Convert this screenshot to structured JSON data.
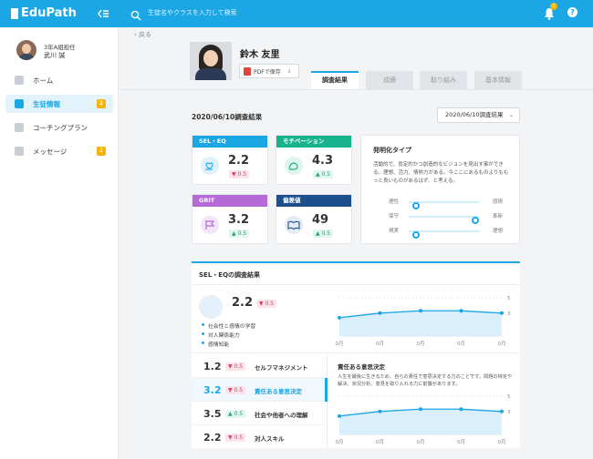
{
  "app": {
    "logo": "EduPath",
    "search_placeholder": "生徒名やクラスを入力して検索",
    "notification_count": "3",
    "help": "?"
  },
  "user": {
    "role": "3年A組担任",
    "name": "武川 誠"
  },
  "nav": [
    {
      "label": "ホーム",
      "icon": "home-icon",
      "count": ""
    },
    {
      "label": "生徒情報",
      "icon": "students-icon",
      "count": "2"
    },
    {
      "label": "コーチングプラン",
      "icon": "book-icon",
      "count": ""
    },
    {
      "label": "メッセージ",
      "icon": "message-icon",
      "count": "2"
    }
  ],
  "header": {
    "back": "‹ 戻る",
    "student_name": "鈴木 友里",
    "pdf": "PDFで保存"
  },
  "tabs": [
    "調査結果",
    "成績",
    "取り組み",
    "基本情報"
  ],
  "survey": {
    "date_title": "2020/06/10調査結果",
    "date_select": "2020/06/10調査結果"
  },
  "metrics": [
    {
      "title": "SEL・EQ",
      "value": "2.2",
      "delta": "▼ 0.5",
      "color": "#1ba6e6"
    },
    {
      "title": "モチベーション",
      "value": "4.3",
      "delta": "▲ 0.5",
      "color": "#16b38c"
    },
    {
      "title": "GRIT",
      "value": "3.2",
      "delta": "▲ 0.5",
      "color": "#b56ad8"
    },
    {
      "title": "偏差値",
      "value": "49",
      "delta": "▲ 0.5",
      "color": "#1d4f8c"
    }
  ],
  "type": {
    "title": "発明化タイプ",
    "desc": "活動的で、肯定的かつ創造的なビジョンを見出す事ができる。理想、活力、情熱力がある。今ここにあるものよりももっと良いものがあるはず、と考える。",
    "sliders": [
      {
        "left": "理性",
        "right": "感情",
        "level": 0.1
      },
      {
        "left": "保守",
        "right": "革新",
        "level": 0.95
      },
      {
        "left": "現実",
        "right": "理想",
        "level": 0.1
      }
    ]
  },
  "sel": {
    "title": "SEL・EQの調査結果",
    "value": "2.2",
    "delta": "▼ 0.5",
    "bullets": [
      "社会性と感情の学習",
      "対人関係能力",
      "感情知能"
    ],
    "chart_data": {
      "type": "area",
      "x": [
        "0月",
        "0月",
        "0月",
        "0月",
        "0月"
      ],
      "y": [
        2.4,
        3.0,
        3.3,
        3.3,
        3.0
      ],
      "ylim": [
        0,
        5
      ],
      "yticks": [
        "5",
        "3"
      ]
    },
    "items": [
      {
        "value": "1.2",
        "delta": "▼ 0.5",
        "name": "セルフマネジメント",
        "dir": "down"
      },
      {
        "value": "3.2",
        "delta": "▼ 0.5",
        "name": "責任ある意思決定",
        "dir": "down"
      },
      {
        "value": "3.5",
        "delta": "▲ 0.5",
        "name": "社会や他者への理解",
        "dir": "up"
      },
      {
        "value": "2.2",
        "delta": "▼ 0.5",
        "name": "対人スキル",
        "dir": "down"
      }
    ],
    "detail_title": "責任ある意思決定",
    "detail_desc": "人生を最後に生きるため、自らの責任で意思決定する力のことです。問題の特定や解決、状況分析、意見を取り入れる力に前響があります。",
    "detail_chart": {
      "type": "area",
      "x": [
        "0月",
        "0月",
        "0月",
        "0月",
        "0月"
      ],
      "y": [
        2.4,
        3.0,
        3.3,
        3.3,
        3.0
      ],
      "ylim": [
        0,
        5
      ],
      "yticks": [
        "5",
        "3"
      ]
    }
  }
}
